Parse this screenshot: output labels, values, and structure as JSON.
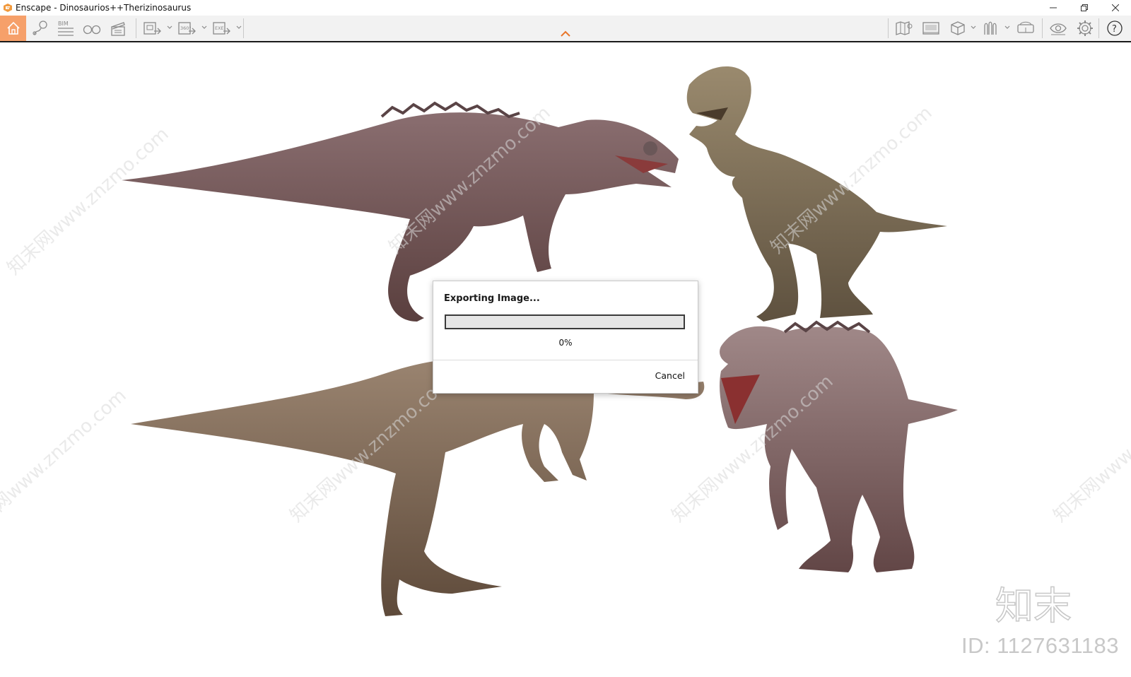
{
  "window": {
    "title": "Enscape - Dinosaurios++Therizinosaurus",
    "controls": [
      "minimize",
      "restore",
      "close"
    ]
  },
  "toolbar": {
    "left_icons": [
      "home-icon",
      "waypoint-icon",
      "bim-icon",
      "binoculars-icon",
      "clapperboard-icon",
      "screenshot-export-icon",
      "panorama-360-icon",
      "exe-export-icon"
    ],
    "bim_label": "BIM",
    "pano_label": "360°",
    "exe_label": "EXE",
    "right_icons": [
      "map-icon",
      "video-editor-icon",
      "cube-icon",
      "asset-library-icon",
      "vr-headset-icon",
      "eye-icon",
      "settings-gear-icon",
      "help-icon"
    ],
    "help_label": "?"
  },
  "dialog": {
    "title": "Exporting Image...",
    "progress_percent_text": "0%",
    "progress_value": 0,
    "cancel_label": "Cancel"
  },
  "viewport": {
    "subject": "Four dinosaur models on a white background",
    "watermark_text": "知末网www.znzmo.com",
    "logo_text": "知末",
    "id_text": "ID: 1127631183"
  },
  "colors": {
    "home_accent": "#f6a06a",
    "toolbar_bg": "#f2f2f2",
    "chevron_accent": "#e8752a"
  }
}
